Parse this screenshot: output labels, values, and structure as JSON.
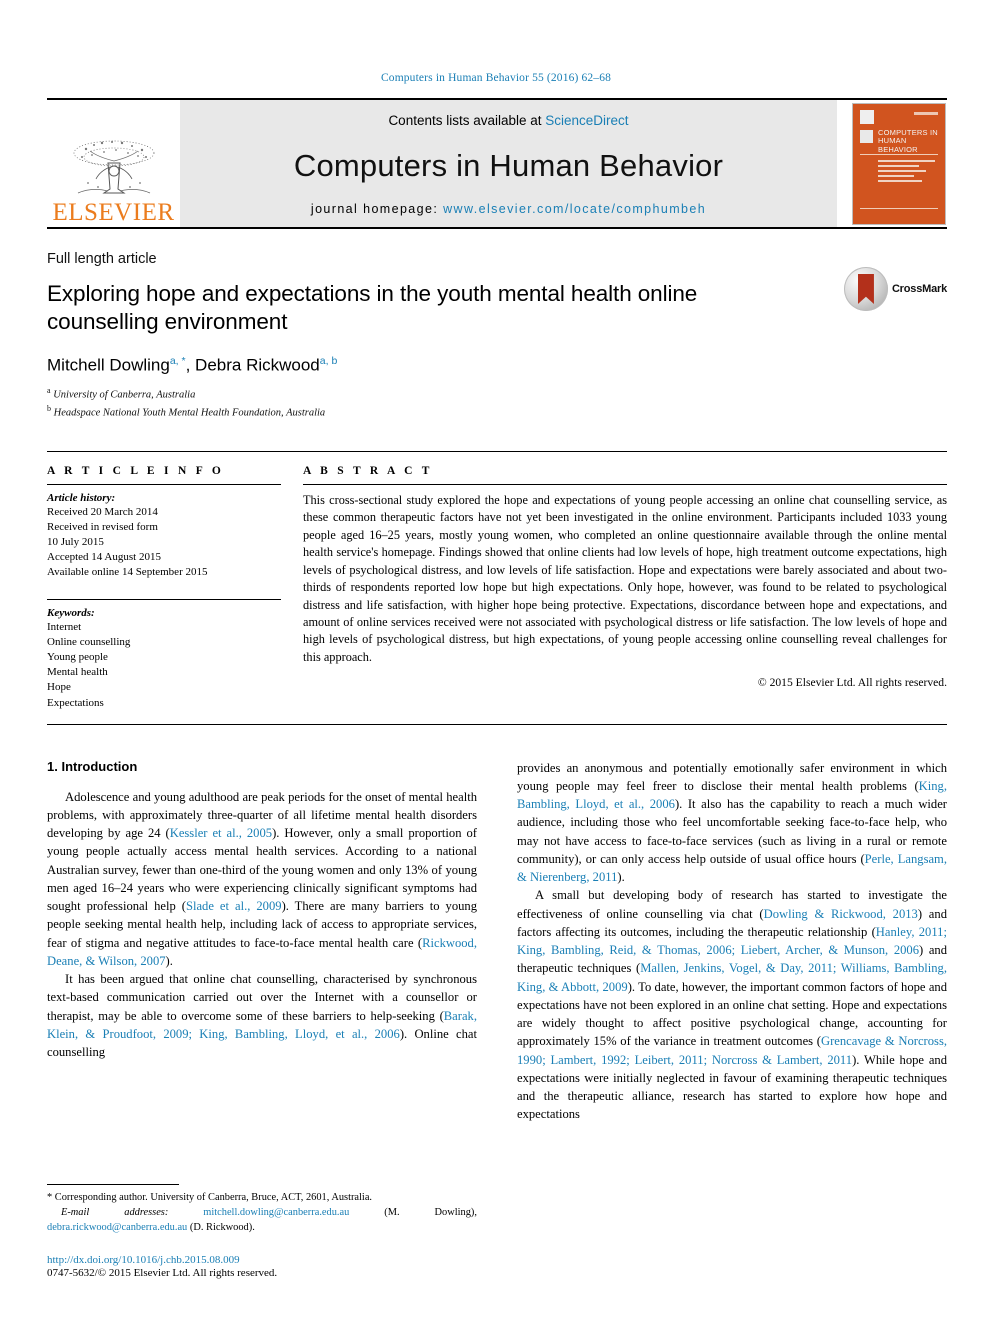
{
  "running_head": "Computers in Human Behavior 55 (2016) 62–68",
  "masthead": {
    "publisher": "ELSEVIER",
    "contents_prefix": "Contents lists available at ",
    "sciencedirect": "ScienceDirect",
    "journal_name": "Computers in Human Behavior",
    "homepage_label": "journal homepage: ",
    "homepage_url": "www.elsevier.com/locate/comphumbeh",
    "cover_title": "COMPUTERS IN HUMAN BEHAVIOR",
    "cover_color": "#d1541f",
    "link_color": "#1a7fb5"
  },
  "article": {
    "type": "Full length article",
    "title": "Exploring hope and expectations in the youth mental health online counselling environment",
    "authors": "Mitchell Dowling a, *, Debra Rickwood a, b",
    "author_list": [
      {
        "name": "Mitchell Dowling",
        "marks": "a, *"
      },
      {
        "name": "Debra Rickwood",
        "marks": "a, b"
      }
    ],
    "affiliations": [
      {
        "mark": "a",
        "text": "University of Canberra, Australia"
      },
      {
        "mark": "b",
        "text": "Headspace National Youth Mental Health Foundation, Australia"
      }
    ],
    "crossmark_label": "CrossMark"
  },
  "article_info": {
    "heading": "A R T I C L E   I N F O",
    "history_label": "Article history:",
    "history": [
      "Received 20 March 2014",
      "Received in revised form",
      "10 July 2015",
      "Accepted 14 August 2015",
      "Available online 14 September 2015"
    ],
    "keywords_label": "Keywords:",
    "keywords": [
      "Internet",
      "Online counselling",
      "Young people",
      "Mental health",
      "Hope",
      "Expectations"
    ]
  },
  "abstract": {
    "heading": "A B S T R A C T",
    "text": "This cross-sectional study explored the hope and expectations of young people accessing an online chat counselling service, as these common therapeutic factors have not yet been investigated in the online environment. Participants included 1033 young people aged 16–25 years, mostly young women, who completed an online questionnaire available through the online mental health service's homepage. Findings showed that online clients had low levels of hope, high treatment outcome expectations, high levels of psychological distress, and low levels of life satisfaction. Hope and expectations were barely associated and about two-thirds of respondents reported low hope but high expectations. Only hope, however, was found to be related to psychological distress and life satisfaction, with higher hope being protective. Expectations, discordance between hope and expectations, and amount of online services received were not associated with psychological distress or life satisfaction. The low levels of hope and high levels of psychological distress, but high expectations, of young people accessing online counselling reveal challenges for this approach.",
    "copyright": "© 2015 Elsevier Ltd. All rights reserved."
  },
  "body": {
    "section_heading": "1. Introduction",
    "left_paragraphs": [
      "Adolescence and young adulthood are peak periods for the onset of mental health problems, with approximately three-quarter of all lifetime mental health disorders developing by age 24 (Kessler et al., 2005). However, only a small proportion of young people actually access mental health services. According to a national Australian survey, fewer than one-third of the young women and only 13% of young men aged 16–24 years who were experiencing clinically significant symptoms had sought professional help (Slade et al., 2009). There are many barriers to young people seeking mental health help, including lack of access to appropriate services, fear of stigma and negative attitudes to face-to-face mental health care (Rickwood, Deane, & Wilson, 2007).",
      "It has been argued that online chat counselling, characterised by synchronous text-based communication carried out over the Internet with a counsellor or therapist, may be able to overcome some of these barriers to help-seeking (Barak, Klein, & Proudfoot, 2009; King, Bambling, Lloyd, et al., 2006). Online chat counselling"
    ],
    "right_paragraphs": [
      "provides an anonymous and potentially emotionally safer environment in which young people may feel freer to disclose their mental health problems (King, Bambling, Lloyd, et al., 2006). It also has the capability to reach a much wider audience, including those who feel uncomfortable seeking face-to-face help, who may not have access to face-to-face services (such as living in a rural or remote community), or can only access help outside of usual office hours (Perle, Langsam, & Nierenberg, 2011).",
      "A small but developing body of research has started to investigate the effectiveness of online counselling via chat (Dowling & Rickwood, 2013) and factors affecting its outcomes, including the therapeutic relationship (Hanley, 2011; King, Bambling, Reid, & Thomas, 2006; Liebert, Archer, & Munson, 2006) and therapeutic techniques (Mallen, Jenkins, Vogel, & Day, 2011; Williams, Bambling, King, & Abbott, 2009). To date, however, the important common factors of hope and expectations have not been explored in an online chat setting. Hope and expectations are widely thought to affect positive psychological change, accounting for approximately 15% of the variance in treatment outcomes (Grencavage & Norcross, 1990; Lambert, 1992; Leibert, 2011; Norcross & Lambert, 2011). While hope and expectations were initially neglected in favour of examining therapeutic techniques and the therapeutic alliance, research has started to explore how hope and expectations"
    ]
  },
  "footnotes": {
    "corresponding": "* Corresponding author. University of Canberra, Bruce, ACT, 2601, Australia.",
    "email_label": "E-mail addresses:",
    "email_1": "mitchell.dowling@canberra.edu.au",
    "email_1_owner": "(M. Dowling),",
    "email_2": "debra.rickwood@canberra.edu.au",
    "email_2_owner": "(D. Rickwood).",
    "doi": "http://dx.doi.org/10.1016/j.chb.2015.08.009",
    "issn": "0747-5632/© 2015 Elsevier Ltd. All rights reserved."
  }
}
